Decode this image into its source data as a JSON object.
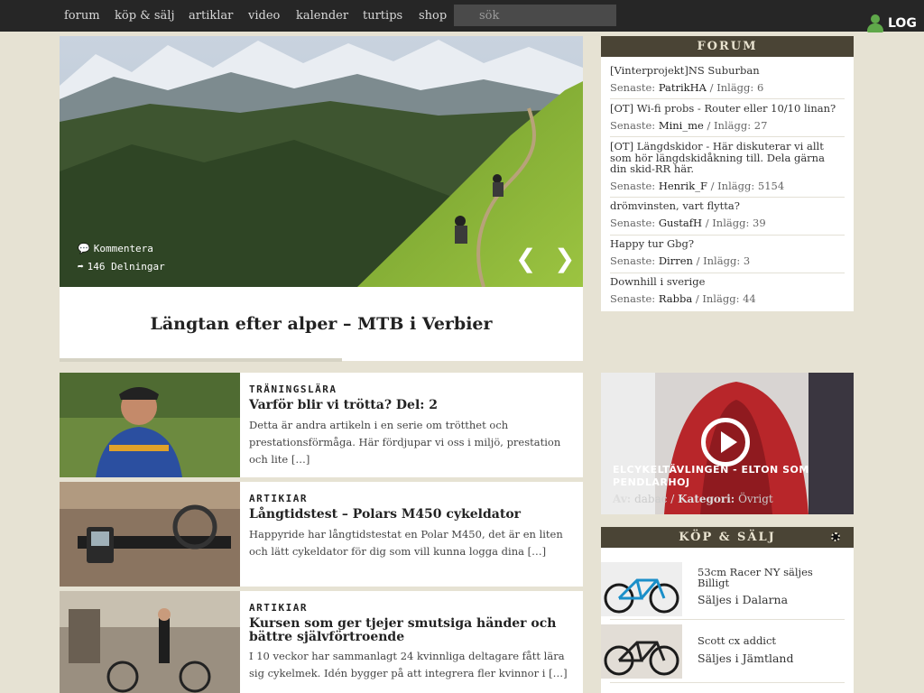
{
  "nav": {
    "items": [
      "forum",
      "köp & sälj",
      "artiklar",
      "video",
      "kalender",
      "turtips",
      "shop"
    ],
    "search_placeholder": "sök",
    "login": "LOG"
  },
  "hero": {
    "comment_label": "Kommentera",
    "shares": "146 Delningar",
    "title": "Längtan efter alper – MTB i Verbier",
    "progress": 0.54
  },
  "articles": [
    {
      "category": "TRÄNINGSLÄRA",
      "title": "Varför blir vi trötta? Del: 2",
      "excerpt": "Detta är andra artikeln i en serie om trötthet och prestationsförmåga. Här fördjupar vi oss i miljö, prestation och lite […]"
    },
    {
      "category": "ARTIKIAR",
      "title": "Långtidstest – Polars M450 cykeldator",
      "excerpt": "Happyride har långtidstestat en Polar M450, det är en liten och lätt cykeldator för dig som vill kunna logga dina […]"
    },
    {
      "category": "ARTIKIAR",
      "title": "Kursen som ger tjejer smutsiga händer och bättre självförtroende",
      "excerpt": "I 10 veckor har sammanlagt 24 kvinnliga deltagare fått lära sig cykelmek. Idén bygger på att integrera fler kvinnor i […]"
    }
  ],
  "forum": {
    "header": "FORUM",
    "latest_label": "Senaste:",
    "posts_label": "Inlägg:",
    "threads": [
      {
        "title": "[Vinterprojekt]NS Suburban",
        "user": "PatrikHA",
        "posts": "6"
      },
      {
        "title": "[OT] Wi-fi probs - Router eller 10/10 linan?",
        "user": "Mini_me",
        "posts": "27"
      },
      {
        "title": "[OT] Längdskidor - Här diskuterar vi allt som hör längdskidåkning till. Dela gärna din skid-RR här.",
        "user": "Henrik_F",
        "posts": "5154"
      },
      {
        "title": "drömvinsten, vart flytta?",
        "user": "GustafH",
        "posts": "39"
      },
      {
        "title": "Happy tur Gbg?",
        "user": "Dirren",
        "posts": "3"
      },
      {
        "title": "Downhill i sverige",
        "user": "Rabba",
        "posts": "44"
      }
    ]
  },
  "video": {
    "title": "ELCYKELTÄVLINGEN - ELTON SOM PENDLARHOJ",
    "author_label": "Av:",
    "author": "dabac",
    "category_label": "Kategori:",
    "category": "Övrigt"
  },
  "kop": {
    "header": "KÖP & SÄLJ",
    "ads": [
      {
        "title": "53cm Racer NY säljes Billigt",
        "location": "Säljes i Dalarna"
      },
      {
        "title": "Scott cx addict",
        "location": "Säljes i Jämtland"
      }
    ]
  }
}
